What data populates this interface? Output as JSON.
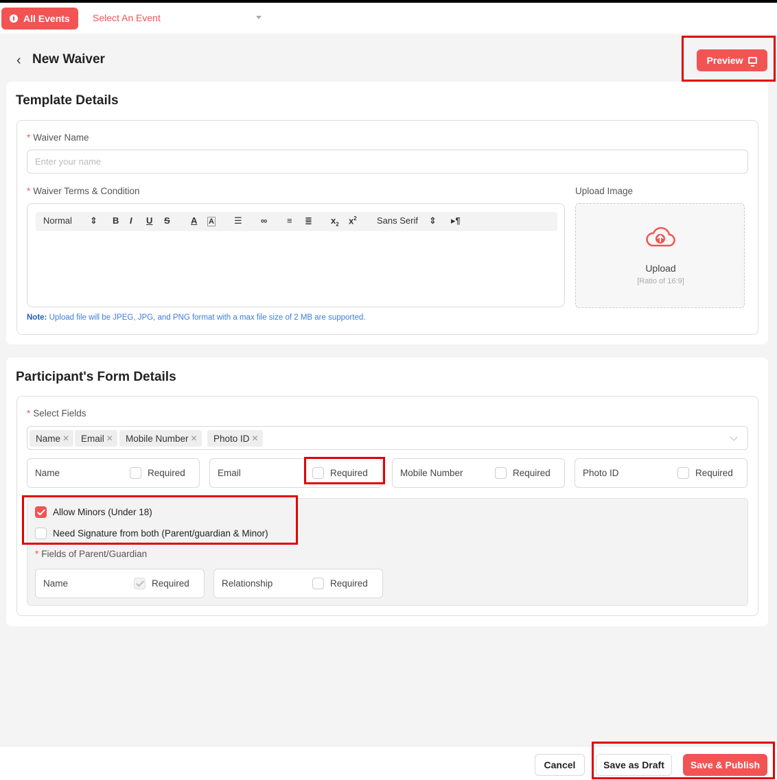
{
  "topbar": {
    "all_events_label": "All Events",
    "event_select_placeholder": "Select An Event"
  },
  "header": {
    "title": "New Waiver",
    "preview_label": "Preview"
  },
  "template": {
    "title": "Template Details",
    "waiver_name_label": "Waiver Name",
    "waiver_name_placeholder": "Enter your name",
    "terms_label": "Waiver Terms & Condition",
    "toolbar": {
      "header_select": "Normal",
      "font_select": "Sans Serif"
    },
    "upload_label": "Upload Image",
    "upload_text": "Upload",
    "upload_hint": "[Ratio of 16:9]",
    "note_prefix": "Note:",
    "note_text": "Upload file will be JPEG, JPG, and PNG format with a max file size of 2 MB are supported."
  },
  "participant": {
    "title": "Participant's Form Details",
    "select_fields_label": "Select Fields",
    "selected_tags": [
      "Name",
      "Email",
      "Mobile Number",
      "Photo ID"
    ],
    "fields": [
      {
        "name": "Name",
        "required_label": "Required",
        "required": false
      },
      {
        "name": "Email",
        "required_label": "Required",
        "required": false
      },
      {
        "name": "Mobile Number",
        "required_label": "Required",
        "required": false
      },
      {
        "name": "Photo ID",
        "required_label": "Required",
        "required": false
      }
    ],
    "allow_minors_label": "Allow Minors (Under 18)",
    "allow_minors_checked": true,
    "both_signature_label": "Need Signature from both (Parent/guardian & Minor)",
    "both_signature_checked": false,
    "guardian_fields_label": "Fields of Parent/Guardian",
    "guardian_fields": [
      {
        "name": "Name",
        "required_label": "Required",
        "required": true
      },
      {
        "name": "Relationship",
        "required_label": "Required",
        "required": false
      }
    ]
  },
  "footer": {
    "cancel_label": "Cancel",
    "draft_label": "Save as Draft",
    "publish_label": "Save & Publish"
  },
  "colors": {
    "accent": "#f25454",
    "highlight": "#e00000",
    "note": "#3b7ddd"
  }
}
